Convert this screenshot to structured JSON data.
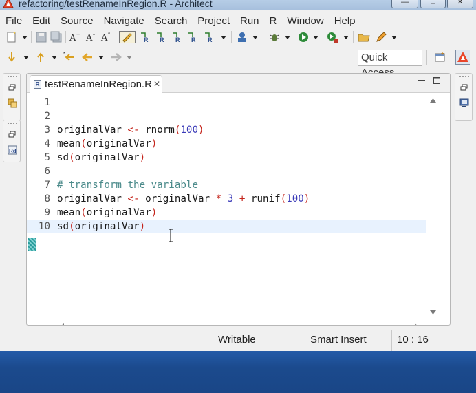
{
  "window": {
    "title": "refactoring/testRenameInRegion.R - Architect"
  },
  "menu": [
    "File",
    "Edit",
    "Source",
    "Navigate",
    "Search",
    "Project",
    "Run",
    "R",
    "Window",
    "Help"
  ],
  "toolbar": {
    "quick_access": "Quick Access"
  },
  "editor": {
    "tab_label": "testRenameInRegion.R",
    "current_line": 10,
    "lines": [
      {
        "n": "1",
        "tokens": []
      },
      {
        "n": "2",
        "tokens": []
      },
      {
        "n": "3",
        "tokens": [
          [
            "id",
            "originalVar "
          ],
          [
            "op",
            "<-"
          ],
          [
            "id",
            " rnorm"
          ],
          [
            "br",
            "("
          ],
          [
            "num",
            "100"
          ],
          [
            "br",
            ")"
          ]
        ]
      },
      {
        "n": "4",
        "tokens": [
          [
            "id",
            "mean"
          ],
          [
            "br",
            "("
          ],
          [
            "id",
            "originalVar"
          ],
          [
            "br",
            ")"
          ]
        ]
      },
      {
        "n": "5",
        "tokens": [
          [
            "id",
            "sd"
          ],
          [
            "br",
            "("
          ],
          [
            "id",
            "originalVar"
          ],
          [
            "br",
            ")"
          ]
        ]
      },
      {
        "n": "6",
        "tokens": []
      },
      {
        "n": "7",
        "tokens": [
          [
            "cm",
            "# transform the variable"
          ]
        ]
      },
      {
        "n": "8",
        "tokens": [
          [
            "id",
            "originalVar "
          ],
          [
            "op",
            "<-"
          ],
          [
            "id",
            " originalVar "
          ],
          [
            "op",
            "*"
          ],
          [
            "num",
            " 3 "
          ],
          [
            "op",
            "+"
          ],
          [
            "id",
            " runif"
          ],
          [
            "br",
            "("
          ],
          [
            "num",
            "100"
          ],
          [
            "br",
            ")"
          ]
        ]
      },
      {
        "n": "9",
        "tokens": [
          [
            "id",
            "mean"
          ],
          [
            "br",
            "("
          ],
          [
            "id",
            "originalVar"
          ],
          [
            "br",
            ")"
          ]
        ]
      },
      {
        "n": "10",
        "tokens": [
          [
            "id",
            "sd"
          ],
          [
            "br",
            "("
          ],
          [
            "id",
            "originalVar"
          ],
          [
            "br",
            ")"
          ]
        ]
      }
    ]
  },
  "status": {
    "writable": "Writable",
    "insert_mode": "Smart Insert",
    "position": "10 : 16"
  },
  "colors": {
    "keyword_red": "#c4231a",
    "number_blue": "#3a3ab8",
    "comment_teal": "#4a8a8a",
    "current_line_bg": "#e8f2fe",
    "taskbar_blue": "#1f4f94"
  }
}
